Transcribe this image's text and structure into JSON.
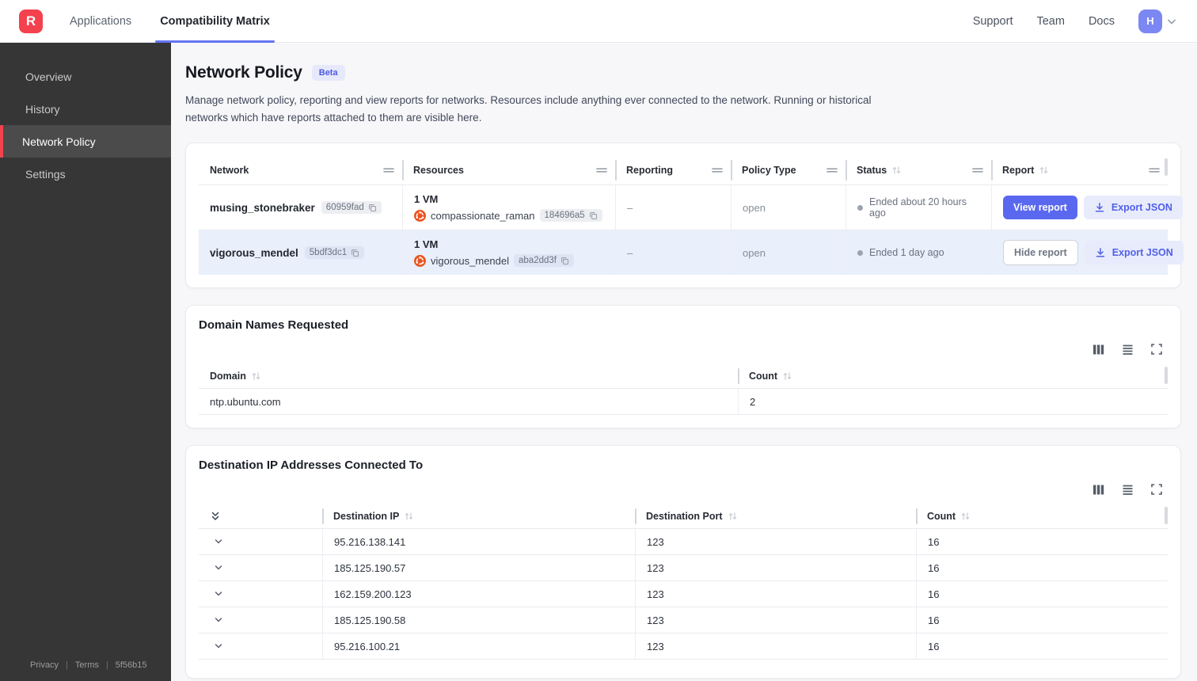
{
  "navbar": {
    "logo_letter": "R",
    "tabs": [
      {
        "label": "Applications"
      },
      {
        "label": "Compatibility Matrix"
      }
    ],
    "links": [
      "Support",
      "Team",
      "Docs"
    ],
    "avatar_letter": "H"
  },
  "sidebar": {
    "items": [
      {
        "label": "Overview"
      },
      {
        "label": "History"
      },
      {
        "label": "Network Policy"
      },
      {
        "label": "Settings"
      }
    ],
    "footer": {
      "privacy": "Privacy",
      "terms": "Terms",
      "version": "5f56b15"
    }
  },
  "page": {
    "title": "Network Policy",
    "beta_badge": "Beta",
    "description": "Manage network policy, reporting and view reports for networks. Resources include anything ever connected to the network. Running or historical networks which have reports attached to them are visible here."
  },
  "networks_table": {
    "columns": [
      "Network",
      "Resources",
      "Reporting",
      "Policy Type",
      "Status",
      "Report"
    ],
    "rows": [
      {
        "name": "musing_stonebraker",
        "id": "60959fad",
        "resources_count": "1 VM",
        "resource_name": "compassionate_raman",
        "resource_id": "184696a5",
        "reporting": "–",
        "policy_type": "open",
        "status": "Ended about 20 hours ago",
        "report_button": "View report",
        "export_button": "Export JSON"
      },
      {
        "name": "vigorous_mendel",
        "id": "5bdf3dc1",
        "resources_count": "1 VM",
        "resource_name": "vigorous_mendel",
        "resource_id": "aba2dd3f",
        "reporting": "–",
        "policy_type": "open",
        "status": "Ended 1 day ago",
        "report_button": "Hide report",
        "export_button": "Export JSON"
      }
    ]
  },
  "domain_card": {
    "title": "Domain Names Requested",
    "columns": [
      "Domain",
      "Count"
    ],
    "rows": [
      {
        "domain": "ntp.ubuntu.com",
        "count": "2"
      }
    ]
  },
  "dest_card": {
    "title": "Destination IP Addresses Connected To",
    "columns": [
      "Destination IP",
      "Destination Port",
      "Count"
    ],
    "rows": [
      {
        "ip": "95.216.138.141",
        "port": "123",
        "count": "16"
      },
      {
        "ip": "185.125.190.57",
        "port": "123",
        "count": "16"
      },
      {
        "ip": "162.159.200.123",
        "port": "123",
        "count": "16"
      },
      {
        "ip": "185.125.190.58",
        "port": "123",
        "count": "16"
      },
      {
        "ip": "95.216.100.21",
        "port": "123",
        "count": "16"
      }
    ]
  },
  "colors": {
    "accent_indigo": "#5a68ef",
    "accent_soft": "#e8ebfc",
    "logo_red": "#f4414e",
    "active_nav_underline": "#6574f1",
    "selected_row": "#e9effb",
    "sidebar_bg": "#363636",
    "sidebar_active_bg": "#4b4b4b",
    "ubuntu_orange": "#e95420"
  }
}
